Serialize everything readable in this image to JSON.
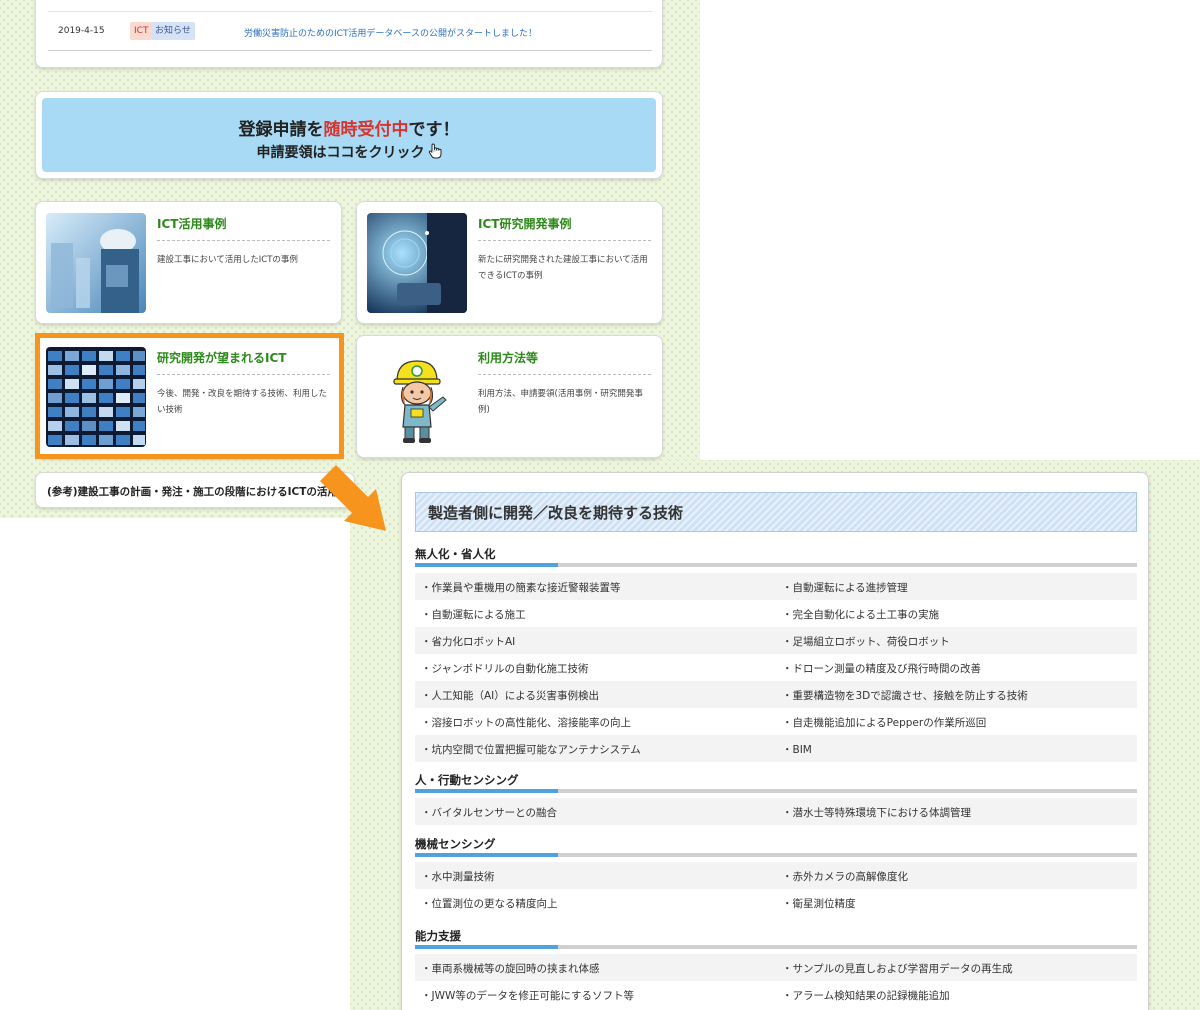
{
  "news": {
    "date": "2019-4-15",
    "tag_ict": "ICT",
    "tag_news": "お知らせ",
    "link": "労働災害防止のためのICT活用データベースの公開がスタートしました！"
  },
  "banner": {
    "main_before": "登録申請を",
    "main_highlight": "随時受付中",
    "main_after": "です！",
    "sub": "申請要領はココをクリック"
  },
  "cards": [
    {
      "title": "ICT活用事例",
      "desc": "建設工事において活用したICTの事例",
      "icon": "construction-worker-photo"
    },
    {
      "title": "ICT研究開発事例",
      "desc": "新たに研究開発された建設工事において活用できるICTの事例",
      "icon": "digital-tablet-photo"
    },
    {
      "title": "研究開発が望まれるICT",
      "desc": "今後、開発・改良を期待する技術、利用したい技術",
      "icon": "video-wall-photo"
    },
    {
      "title": "利用方法等",
      "desc": "利用方法、申請要領(活用事例・研究開発事例)",
      "icon": "mascot-helmet-character"
    }
  ],
  "ref": {
    "text": "(参考)建設工事の計画・発注・施工の段階におけるICTの活用"
  },
  "colors": {
    "accent_orange": "#f7941d",
    "title_green": "#2d8a1a",
    "banner_blue": "#a8daf5",
    "highlight_red": "#d8332c",
    "link_blue": "#2b6fc4"
  },
  "panel": {
    "title": "製造者側に開発／改良を期待する技術",
    "sections": [
      {
        "heading": "無人化・省人化",
        "rows": [
          [
            "・作業員や重機用の簡素な接近警報装置等",
            "・自動運転による進捗管理"
          ],
          [
            "・自動運転による施工",
            "・完全自動化による土工事の実施"
          ],
          [
            "・省力化ロボットAI",
            "・足場組立ロボット、荷役ロボット"
          ],
          [
            "・ジャンボドリルの自動化施工技術",
            "・ドローン測量の精度及び飛行時間の改善"
          ],
          [
            "・人工知能（AI）による災害事例検出",
            "・重要構造物を3Dで認識させ、接触を防止する技術"
          ],
          [
            "・溶接ロボットの高性能化、溶接能率の向上",
            "・自走機能追加によるPepperの作業所巡回"
          ],
          [
            "・坑内空間で位置把握可能なアンテナシステム",
            "・BIM"
          ]
        ]
      },
      {
        "heading": "人・行動センシング",
        "rows": [
          [
            "・バイタルセンサーとの融合",
            "・潜水士等特殊環境下における体調管理"
          ]
        ]
      },
      {
        "heading": "機械センシング",
        "rows": [
          [
            "・水中測量技術",
            "・赤外カメラの高解像度化"
          ],
          [
            "・位置測位の更なる精度向上",
            "・衛星測位精度"
          ]
        ]
      },
      {
        "heading": "能力支援",
        "rows": [
          [
            "・車両系機械等の旋回時の挟まれ体感",
            "・サンプルの見直しおよび学習用データの再生成"
          ],
          [
            "・JWW等のデータを修正可能にするソフト等",
            "・アラーム検知結果の記録機能追加"
          ]
        ]
      }
    ]
  }
}
